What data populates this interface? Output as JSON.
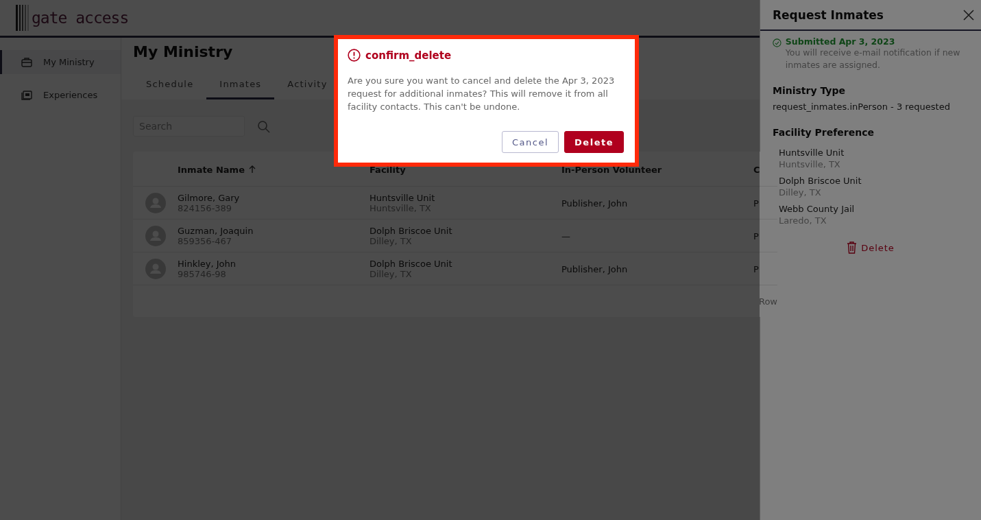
{
  "header": {
    "logo": "gate access"
  },
  "sidebar": {
    "items": [
      {
        "label": "My Ministry",
        "selected": true
      },
      {
        "label": "Experiences",
        "selected": false
      }
    ]
  },
  "page": {
    "title": "My Ministry",
    "tabs": [
      {
        "label": "Schedule",
        "selected": false
      },
      {
        "label": "Inmates",
        "selected": true
      },
      {
        "label": "Activity",
        "selected": false
      }
    ],
    "search": {
      "placeholder": "Search"
    },
    "table": {
      "columns": [
        {
          "label": "Inmate Name",
          "sorted": true
        },
        {
          "label": "Facility",
          "sorted": false
        },
        {
          "label": "In-Person Volunteer",
          "sorted": false
        },
        {
          "label": "C",
          "sorted": false
        }
      ],
      "rows": [
        {
          "name": "Gilmore, Gary",
          "number": "824156-389",
          "facility": "Huntsville Unit",
          "location": "Huntsville, TX",
          "volunteer": "Publisher, John",
          "column_4": "P"
        },
        {
          "name": "Guzman, Joaquin",
          "number": "859356-467",
          "facility": "Dolph Briscoe Unit",
          "location": "Dilley, TX",
          "volunteer": "—",
          "column_4": "P"
        },
        {
          "name": "Hinkley, John",
          "number": "985746-98",
          "facility": "Dolph Briscoe Unit",
          "location": "Dilley, TX",
          "volunteer": "Publisher, John",
          "column_4": "P"
        }
      ],
      "footer": "Row"
    }
  },
  "drawer": {
    "title": "Request Inmates",
    "status": {
      "title": "Submitted Apr 3, 2023",
      "text": "You will receive e-mail notification if new inmates are assigned."
    },
    "ministry_type": {
      "heading": "Ministry Type",
      "value": "request_inmates.inPerson - 3 requested"
    },
    "facility_preference": {
      "heading": "Facility Preference",
      "facilities": [
        {
          "name": "Huntsville Unit",
          "location": "Huntsville, TX"
        },
        {
          "name": "Dolph Briscoe Unit",
          "location": "Dilley, TX"
        },
        {
          "name": "Webb County Jail",
          "location": "Laredo, TX"
        }
      ]
    },
    "delete_button": "Delete"
  },
  "dialog": {
    "title": "confirm_delete",
    "message": "Are you sure you want to cancel and delete the Apr 3, 2023 request for additional inmates? This will remove it from all facility contacts. This can't be undone.",
    "buttons": [
      {
        "label": "Cancel",
        "kind": "secondary"
      },
      {
        "label": "Delete",
        "kind": "danger"
      }
    ]
  }
}
